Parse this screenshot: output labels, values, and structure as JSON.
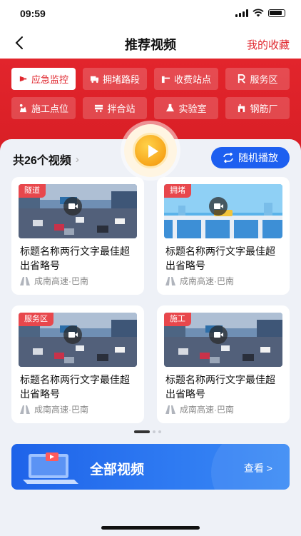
{
  "status": {
    "time": "09:59"
  },
  "nav": {
    "title": "推荐视频",
    "favorites": "我的收藏"
  },
  "categories": [
    {
      "label": "应急监控",
      "icon": "siren-icon",
      "active": true
    },
    {
      "label": "拥堵路段",
      "icon": "truck-icon",
      "active": false
    },
    {
      "label": "收费站点",
      "icon": "toll-gate-icon",
      "active": false
    },
    {
      "label": "服务区",
      "icon": "parking-icon",
      "active": false
    },
    {
      "label": "施工点位",
      "icon": "construction-icon",
      "active": false
    },
    {
      "label": "拌合站",
      "icon": "mixer-icon",
      "active": false
    },
    {
      "label": "实验室",
      "icon": "lab-icon",
      "active": false
    },
    {
      "label": "钢筋厂",
      "icon": "factory-icon",
      "active": false
    }
  ],
  "list": {
    "count_label": "共26个视频",
    "random_label": "随机播放"
  },
  "videos": [
    {
      "tag": "隧道",
      "title": "标题名称两行文字最佳超出省略号",
      "location": "成南高速·巴南",
      "scene": "traffic"
    },
    {
      "tag": "拥堵",
      "title": "标题名称两行文字最佳超出省略号",
      "location": "成南高速·巴南",
      "scene": "bridge"
    },
    {
      "tag": "服务区",
      "title": "标题名称两行文字最佳超出省略号",
      "location": "成南高速·巴南",
      "scene": "traffic"
    },
    {
      "tag": "施工",
      "title": "标题名称两行文字最佳超出省略号",
      "location": "成南高速·巴南",
      "scene": "traffic"
    }
  ],
  "pager": {
    "total": 3,
    "current": 1
  },
  "banner": {
    "label": "全部视频",
    "more": "查看 >"
  },
  "colors": {
    "brand_red": "#e0272e",
    "accent_blue": "#1d5ff0",
    "tag_red": "#e8474c"
  }
}
